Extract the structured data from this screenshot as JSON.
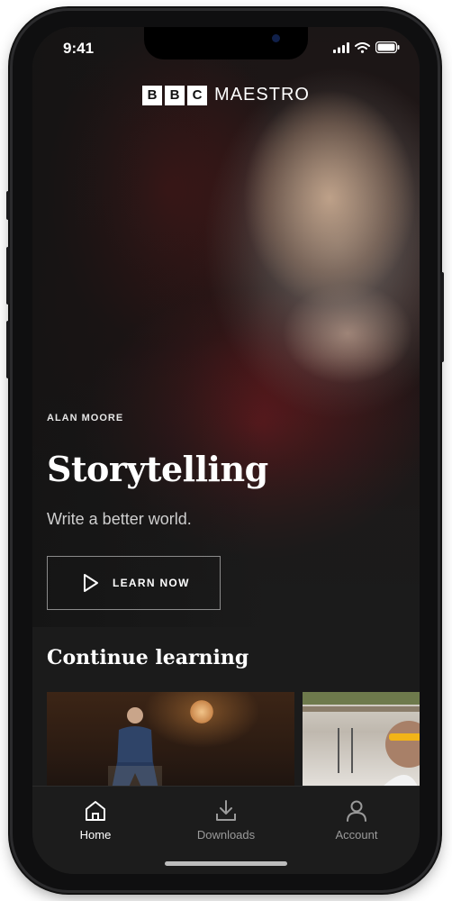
{
  "status_bar": {
    "time": "9:41"
  },
  "brand": {
    "letters": [
      "B",
      "B",
      "C"
    ],
    "word": "MAESTRO"
  },
  "hero": {
    "author": "ALAN MOORE",
    "title": "Storytelling",
    "subtitle": "Write a better world.",
    "button_label": "LEARN NOW"
  },
  "continue": {
    "title": "Continue  learning"
  },
  "tabs": [
    {
      "label": "Home",
      "icon": "home-icon",
      "active": true
    },
    {
      "label": "Downloads",
      "icon": "download-icon",
      "active": false
    },
    {
      "label": "Account",
      "icon": "user-icon",
      "active": false
    }
  ],
  "colors": {
    "background": "#1b1b1b",
    "active_tab": "#ffffff",
    "inactive_tab": "#9a9a9a",
    "button_border": "#8b8b8b"
  }
}
